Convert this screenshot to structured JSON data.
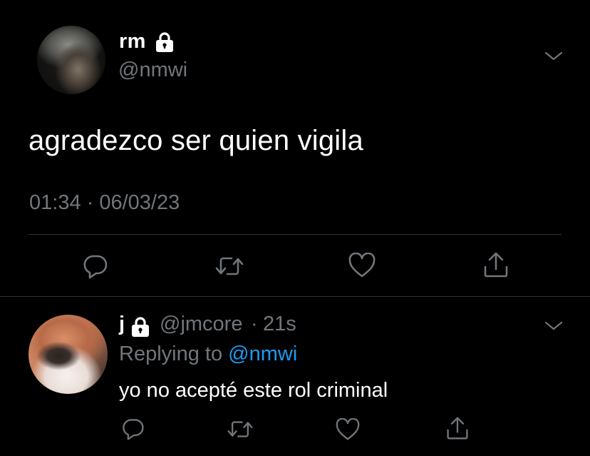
{
  "tweet": {
    "author_name": "rm",
    "author_handle": "@nmwi",
    "text": "agradezco ser quien vigila",
    "timestamp": "01:34 · 06/03/23",
    "actions": [
      "reply-icon",
      "retweet-icon",
      "like-icon",
      "share-icon"
    ]
  },
  "reply": {
    "author_name": "j",
    "author_handle": "@jmcore",
    "separator": "·",
    "time": "21s",
    "replying_prefix": "Replying to",
    "replying_to": "@nmwi",
    "text": "yo no acepté este rol criminal",
    "actions": [
      "reply-icon",
      "retweet-icon",
      "like-icon",
      "share-icon"
    ]
  },
  "colors": {
    "background": "#000000",
    "primary_text": "#ffffff",
    "secondary_text": "#71767b",
    "link": "#1d9bf0",
    "divider": "#2f3336"
  }
}
